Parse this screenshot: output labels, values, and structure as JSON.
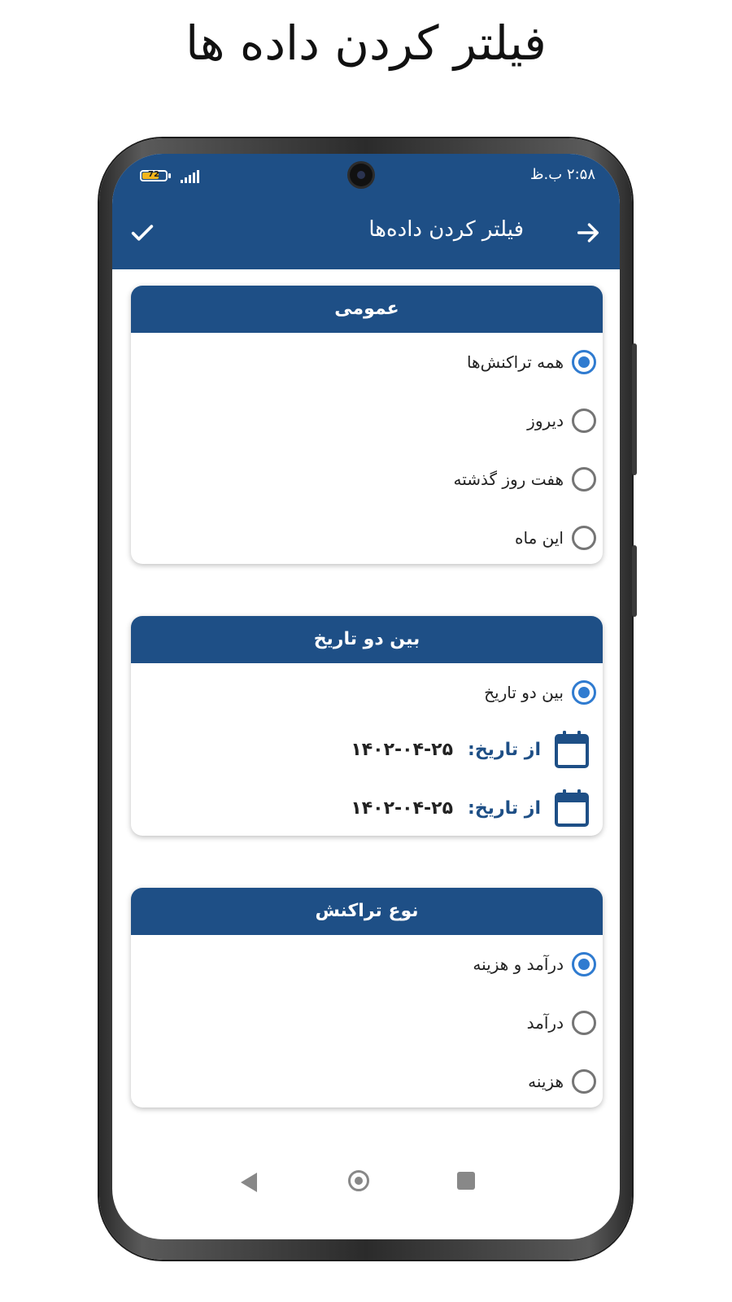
{
  "promo": {
    "title": "فیلتر کردن داده ها"
  },
  "status_bar": {
    "time": "۲:۵۸ ب.ظ",
    "battery": "72",
    "battery_level": 0.72
  },
  "app_bar": {
    "title": "فیلتر کردن داده‌ها",
    "back_icon": "arrow-right-icon",
    "confirm_icon": "check-icon"
  },
  "general": {
    "header": "عمومی",
    "options": [
      {
        "label": "همه تراکنش‌ها",
        "selected": true
      },
      {
        "label": "دیروز",
        "selected": false
      },
      {
        "label": "هفت روز گذشته",
        "selected": false
      },
      {
        "label": "این ماه",
        "selected": false
      }
    ]
  },
  "date_range": {
    "header": "بین دو تاریخ",
    "option": {
      "label": "بین دو تاریخ",
      "selected": true
    },
    "from": {
      "label": "از تاریخ:",
      "value": "۱۴۰۲-۰۴-۲۵"
    },
    "to": {
      "label": "از تاریخ:",
      "value": "۱۴۰۲-۰۴-۲۵"
    }
  },
  "transaction_type": {
    "header": "نوع تراکنش",
    "options": [
      {
        "label": "درآمد و هزینه",
        "selected": true
      },
      {
        "label": "درآمد",
        "selected": false
      },
      {
        "label": "هزینه",
        "selected": false
      }
    ]
  },
  "colors": {
    "primary": "#1e4f86",
    "radio_active": "#2f7bd0",
    "radio_inactive": "#757575"
  }
}
